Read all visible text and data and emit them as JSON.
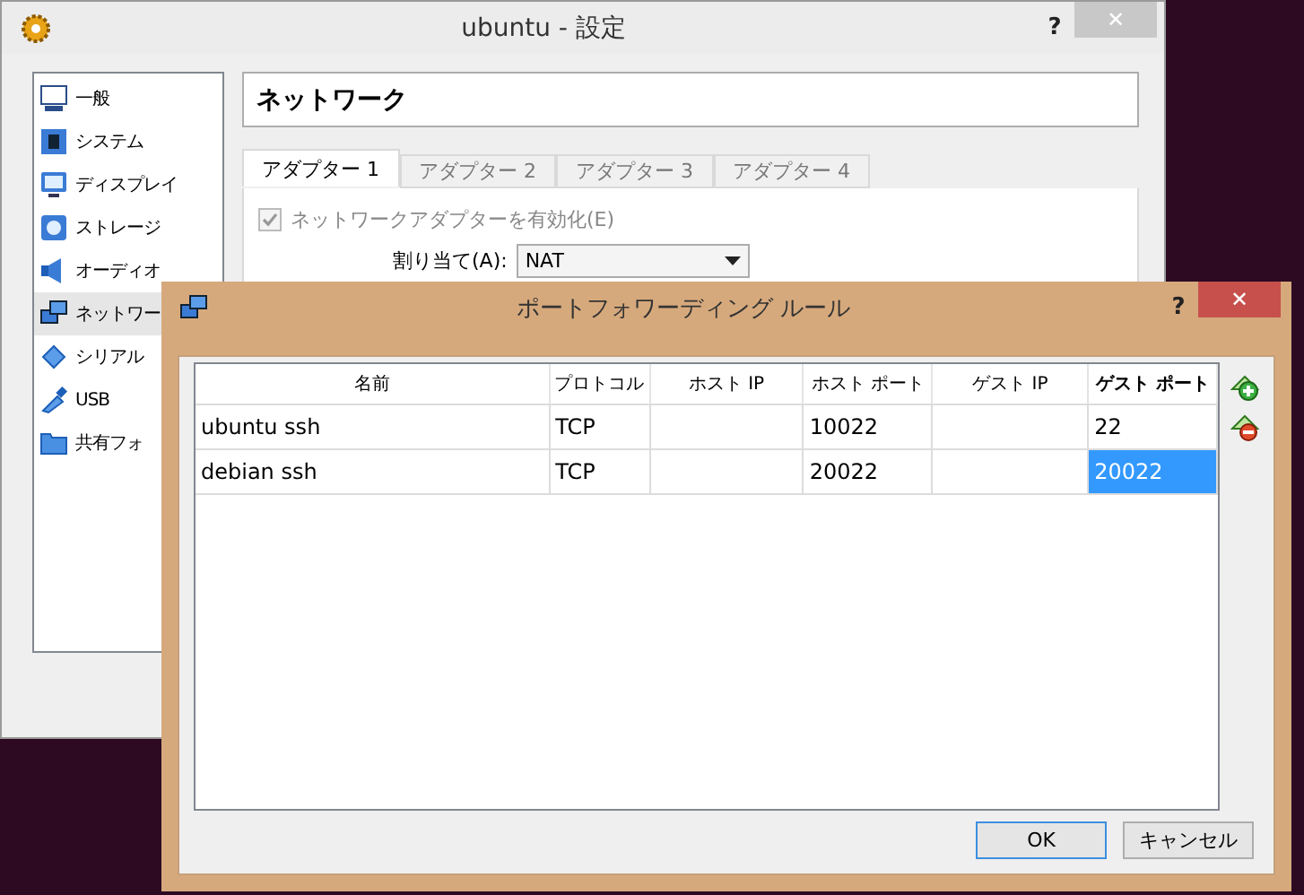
{
  "window": {
    "title": "ubuntu - 設定",
    "help": "?",
    "close": "✕"
  },
  "sidebar": {
    "items": [
      {
        "label": "一般",
        "selected": false
      },
      {
        "label": "システム",
        "selected": false
      },
      {
        "label": "ディスプレイ",
        "selected": false
      },
      {
        "label": "ストレージ",
        "selected": false
      },
      {
        "label": "オーディオ",
        "selected": false
      },
      {
        "label": "ネットワー",
        "selected": true
      },
      {
        "label": "シリアル",
        "selected": false
      },
      {
        "label": "USB",
        "selected": false
      },
      {
        "label": "共有フォ",
        "selected": false
      }
    ]
  },
  "section_title": "ネットワーク",
  "tabs": [
    {
      "label": "アダプター 1",
      "selected": true
    },
    {
      "label": "アダプター 2",
      "selected": false
    },
    {
      "label": "アダプター 3",
      "selected": false
    },
    {
      "label": "アダプター 4",
      "selected": false
    }
  ],
  "adapter": {
    "enable": {
      "label": "ネットワークアダプターを有効化(E)",
      "checked": true,
      "disabled": true
    },
    "attached_to": {
      "label": "割り当て(A):",
      "value": "NAT"
    }
  },
  "dialog": {
    "title": "ポートフォワーディング ルール",
    "help": "?",
    "close": "✕",
    "table": {
      "columns": [
        {
          "label": "名前",
          "sorted": false
        },
        {
          "label": "プロトコル",
          "sorted": false
        },
        {
          "label": "ホスト IP",
          "sorted": false
        },
        {
          "label": "ホスト ポート",
          "sorted": false
        },
        {
          "label": "ゲスト IP",
          "sorted": false
        },
        {
          "label": "ゲスト ポート",
          "sorted": true
        }
      ],
      "rows": [
        {
          "cells": [
            {
              "text": "ubuntu ssh",
              "selected": false
            },
            {
              "text": "TCP",
              "selected": false
            },
            {
              "selected": false
            },
            {
              "text": "10022",
              "selected": false
            },
            {
              "selected": false
            },
            {
              "text": "22",
              "selected": false
            }
          ]
        },
        {
          "cells": [
            {
              "text": "debian ssh",
              "selected": false
            },
            {
              "text": "TCP",
              "selected": false
            },
            {
              "selected": false
            },
            {
              "text": "20022",
              "selected": false
            },
            {
              "selected": false
            },
            {
              "text": "20022",
              "selected": true
            }
          ]
        }
      ]
    },
    "buttons": [
      {
        "label": "OK",
        "focused": true
      },
      {
        "label": "キャンセル",
        "focused": false
      }
    ]
  }
}
